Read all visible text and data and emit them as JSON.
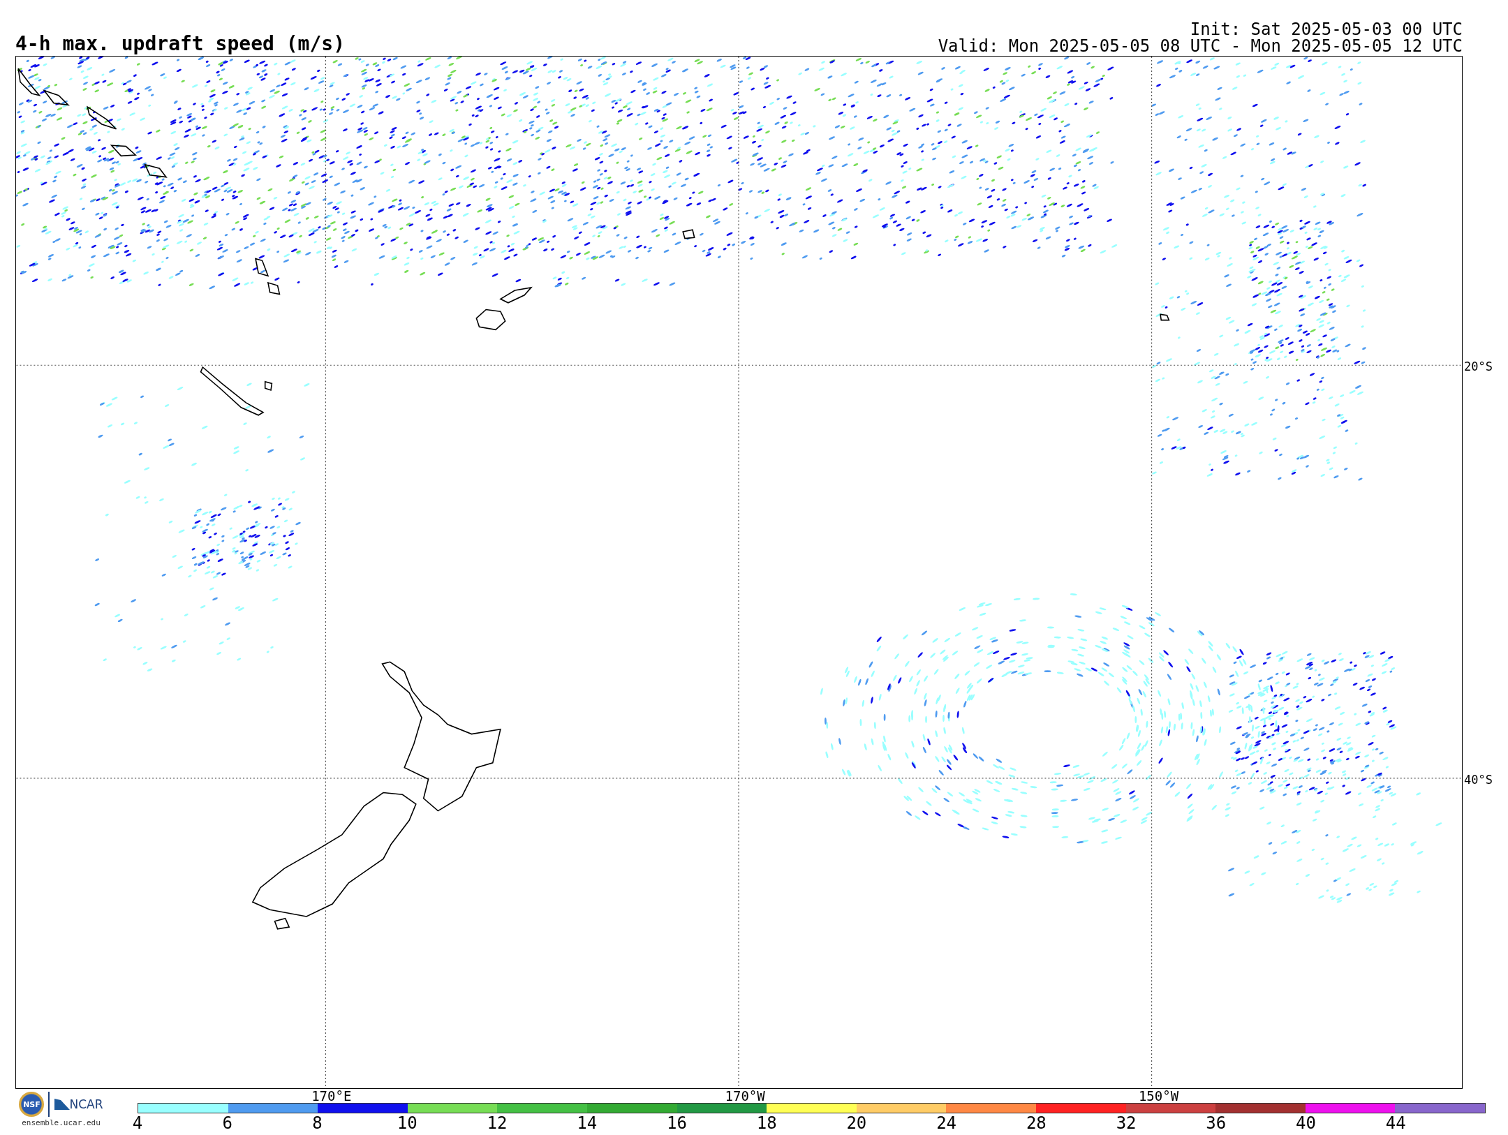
{
  "title": "4-h max. updraft speed (m/s)",
  "init": "Init: Sat 2025-05-03 00 UTC",
  "valid": "Valid: Mon 2025-05-05 08 UTC - Mon 2025-05-05 12 UTC",
  "map": {
    "latitude_labels": [
      "20°S",
      "40°S"
    ],
    "longitude_labels": [
      "170°E",
      "170°W",
      "150°W"
    ]
  },
  "logo": {
    "nsf": "NSF",
    "ncar": "NCAR",
    "url": "ensemble.ucar.edu"
  },
  "colorbar": {
    "segments": [
      {
        "color": "#99ffff",
        "label": "4"
      },
      {
        "color": "#4f9bf0",
        "label": "6"
      },
      {
        "color": "#1010ee",
        "label": "8"
      },
      {
        "color": "#77dd55",
        "label": "10"
      },
      {
        "color": "#44c044",
        "label": "12"
      },
      {
        "color": "#33aa33",
        "label": "14"
      },
      {
        "color": "#229944",
        "label": "16"
      },
      {
        "color": "#ffff55",
        "label": "18"
      },
      {
        "color": "#ffcc66",
        "label": "20"
      },
      {
        "color": "#ff8844",
        "label": "24"
      },
      {
        "color": "#ff2222",
        "label": "28"
      },
      {
        "color": "#cc4040",
        "label": "32"
      },
      {
        "color": "#a33030",
        "label": "36"
      },
      {
        "color": "#ee11ee",
        "label": "40"
      },
      {
        "color": "#8866cc",
        "label": "44"
      }
    ]
  }
}
